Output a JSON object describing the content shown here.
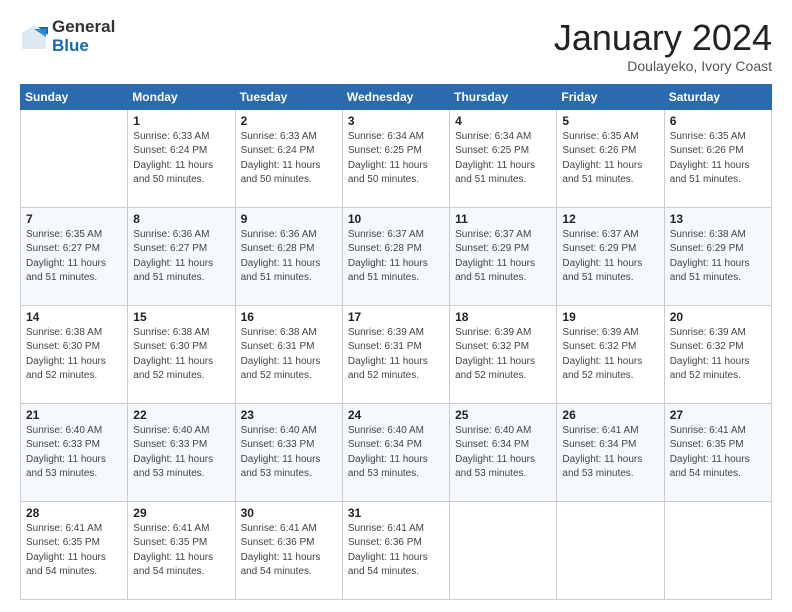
{
  "logo": {
    "general": "General",
    "blue": "Blue"
  },
  "header": {
    "month": "January 2024",
    "location": "Doulayeko, Ivory Coast"
  },
  "weekdays": [
    "Sunday",
    "Monday",
    "Tuesday",
    "Wednesday",
    "Thursday",
    "Friday",
    "Saturday"
  ],
  "weeks": [
    [
      {
        "day": "",
        "info": ""
      },
      {
        "day": "1",
        "info": "Sunrise: 6:33 AM\nSunset: 6:24 PM\nDaylight: 11 hours\nand 50 minutes."
      },
      {
        "day": "2",
        "info": "Sunrise: 6:33 AM\nSunset: 6:24 PM\nDaylight: 11 hours\nand 50 minutes."
      },
      {
        "day": "3",
        "info": "Sunrise: 6:34 AM\nSunset: 6:25 PM\nDaylight: 11 hours\nand 50 minutes."
      },
      {
        "day": "4",
        "info": "Sunrise: 6:34 AM\nSunset: 6:25 PM\nDaylight: 11 hours\nand 51 minutes."
      },
      {
        "day": "5",
        "info": "Sunrise: 6:35 AM\nSunset: 6:26 PM\nDaylight: 11 hours\nand 51 minutes."
      },
      {
        "day": "6",
        "info": "Sunrise: 6:35 AM\nSunset: 6:26 PM\nDaylight: 11 hours\nand 51 minutes."
      }
    ],
    [
      {
        "day": "7",
        "info": "Sunrise: 6:35 AM\nSunset: 6:27 PM\nDaylight: 11 hours\nand 51 minutes."
      },
      {
        "day": "8",
        "info": "Sunrise: 6:36 AM\nSunset: 6:27 PM\nDaylight: 11 hours\nand 51 minutes."
      },
      {
        "day": "9",
        "info": "Sunrise: 6:36 AM\nSunset: 6:28 PM\nDaylight: 11 hours\nand 51 minutes."
      },
      {
        "day": "10",
        "info": "Sunrise: 6:37 AM\nSunset: 6:28 PM\nDaylight: 11 hours\nand 51 minutes."
      },
      {
        "day": "11",
        "info": "Sunrise: 6:37 AM\nSunset: 6:29 PM\nDaylight: 11 hours\nand 51 minutes."
      },
      {
        "day": "12",
        "info": "Sunrise: 6:37 AM\nSunset: 6:29 PM\nDaylight: 11 hours\nand 51 minutes."
      },
      {
        "day": "13",
        "info": "Sunrise: 6:38 AM\nSunset: 6:29 PM\nDaylight: 11 hours\nand 51 minutes."
      }
    ],
    [
      {
        "day": "14",
        "info": "Sunrise: 6:38 AM\nSunset: 6:30 PM\nDaylight: 11 hours\nand 52 minutes."
      },
      {
        "day": "15",
        "info": "Sunrise: 6:38 AM\nSunset: 6:30 PM\nDaylight: 11 hours\nand 52 minutes."
      },
      {
        "day": "16",
        "info": "Sunrise: 6:38 AM\nSunset: 6:31 PM\nDaylight: 11 hours\nand 52 minutes."
      },
      {
        "day": "17",
        "info": "Sunrise: 6:39 AM\nSunset: 6:31 PM\nDaylight: 11 hours\nand 52 minutes."
      },
      {
        "day": "18",
        "info": "Sunrise: 6:39 AM\nSunset: 6:32 PM\nDaylight: 11 hours\nand 52 minutes."
      },
      {
        "day": "19",
        "info": "Sunrise: 6:39 AM\nSunset: 6:32 PM\nDaylight: 11 hours\nand 52 minutes."
      },
      {
        "day": "20",
        "info": "Sunrise: 6:39 AM\nSunset: 6:32 PM\nDaylight: 11 hours\nand 52 minutes."
      }
    ],
    [
      {
        "day": "21",
        "info": "Sunrise: 6:40 AM\nSunset: 6:33 PM\nDaylight: 11 hours\nand 53 minutes."
      },
      {
        "day": "22",
        "info": "Sunrise: 6:40 AM\nSunset: 6:33 PM\nDaylight: 11 hours\nand 53 minutes."
      },
      {
        "day": "23",
        "info": "Sunrise: 6:40 AM\nSunset: 6:33 PM\nDaylight: 11 hours\nand 53 minutes."
      },
      {
        "day": "24",
        "info": "Sunrise: 6:40 AM\nSunset: 6:34 PM\nDaylight: 11 hours\nand 53 minutes."
      },
      {
        "day": "25",
        "info": "Sunrise: 6:40 AM\nSunset: 6:34 PM\nDaylight: 11 hours\nand 53 minutes."
      },
      {
        "day": "26",
        "info": "Sunrise: 6:41 AM\nSunset: 6:34 PM\nDaylight: 11 hours\nand 53 minutes."
      },
      {
        "day": "27",
        "info": "Sunrise: 6:41 AM\nSunset: 6:35 PM\nDaylight: 11 hours\nand 54 minutes."
      }
    ],
    [
      {
        "day": "28",
        "info": "Sunrise: 6:41 AM\nSunset: 6:35 PM\nDaylight: 11 hours\nand 54 minutes."
      },
      {
        "day": "29",
        "info": "Sunrise: 6:41 AM\nSunset: 6:35 PM\nDaylight: 11 hours\nand 54 minutes."
      },
      {
        "day": "30",
        "info": "Sunrise: 6:41 AM\nSunset: 6:36 PM\nDaylight: 11 hours\nand 54 minutes."
      },
      {
        "day": "31",
        "info": "Sunrise: 6:41 AM\nSunset: 6:36 PM\nDaylight: 11 hours\nand 54 minutes."
      },
      {
        "day": "",
        "info": ""
      },
      {
        "day": "",
        "info": ""
      },
      {
        "day": "",
        "info": ""
      }
    ]
  ]
}
